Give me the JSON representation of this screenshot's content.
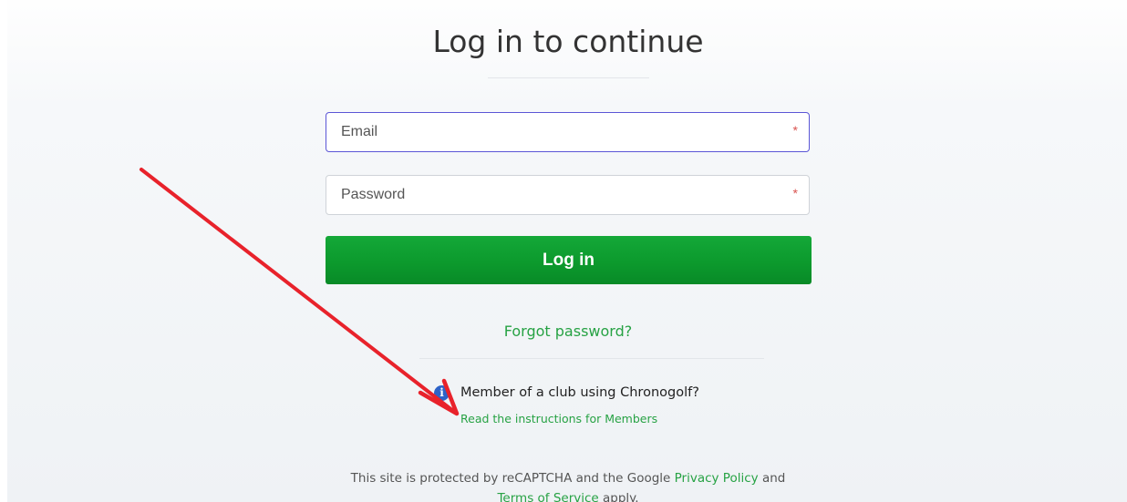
{
  "page": {
    "title": "Log in to continue"
  },
  "form": {
    "email": {
      "placeholder": "Email",
      "value": "",
      "required_mark": "*"
    },
    "password": {
      "placeholder": "Password",
      "value": "",
      "required_mark": "*"
    },
    "submit_label": "Log in",
    "forgot_label": "Forgot password?"
  },
  "members": {
    "icon": "info-icon",
    "icon_glyph": "i",
    "question": "Member of a club using Chronogolf?",
    "link_label": "Read the instructions for Members"
  },
  "recaptcha": {
    "line1_prefix": "This site is protected by reCAPTCHA and the Google ",
    "privacy_label": "Privacy Policy",
    "line1_suffix": " and",
    "terms_label": "Terms of Service",
    "line2_suffix": " apply."
  },
  "annotation": {
    "color": "#e8222b"
  },
  "colors": {
    "accent_green": "#27a244",
    "button_green": "#0c9a2d",
    "focus_border": "#5b56d6",
    "required_red": "#d9534f",
    "info_blue": "#2d63c8"
  }
}
